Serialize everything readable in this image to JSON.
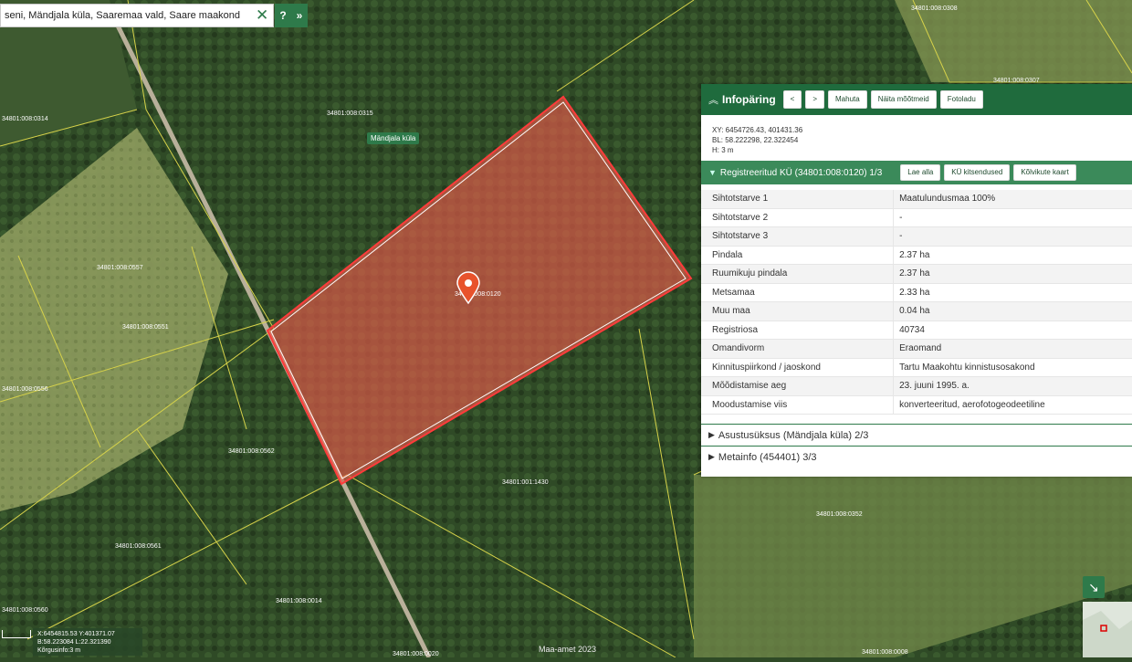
{
  "search": {
    "value": "seni, Mändjala küla, Saaremaa vald, Saare maakond"
  },
  "map": {
    "village_label": "Mändjala küla",
    "selected_parcel_label": "34801:008:0120",
    "parcel_labels": [
      "34801:008:0314",
      "34801:008:0315",
      "34801:008:0557",
      "34801:008:0551",
      "34801:008:0556",
      "34801:008:0562",
      "34801:008:0561",
      "34801:008:0014",
      "34801:008:0560",
      "34801:001:1430",
      "34801:008:0352",
      "34801:008:0308",
      "34801:008:0307",
      "34801:008:0020",
      "34801:008:0008"
    ],
    "copyright": "Maa-amet 2023"
  },
  "infopanel": {
    "title": "Infopäring",
    "buttons": [
      "<",
      ">",
      "Mahuta",
      "Näita mõõtmeid",
      "Fotoladu"
    ],
    "xy": "XY: 6454726.43, 401431.36",
    "bl": "BL: 58.222298, 22.322454",
    "h": "H: 3 m",
    "registered": {
      "title": "Registreeritud KÜ (34801:008:0120) 1/3",
      "buttons": [
        "Lae alla",
        "KÜ kitsendused",
        "Kõlvikute kaart"
      ],
      "rows": [
        {
          "label": "Sihtotstarve 1",
          "value": "Maatulundusmaa 100%"
        },
        {
          "label": "Sihtotstarve 2",
          "value": "-"
        },
        {
          "label": "Sihtotstarve 3",
          "value": "-"
        },
        {
          "label": "Pindala",
          "value": "2.37 ha"
        },
        {
          "label": "Ruumikuju pindala",
          "value": "2.37 ha"
        },
        {
          "label": "Metsamaa",
          "value": "2.33 ha"
        },
        {
          "label": "Muu maa",
          "value": "0.04 ha"
        },
        {
          "label": "Registriosa",
          "value": "40734"
        },
        {
          "label": "Omandivorm",
          "value": "Eraomand"
        },
        {
          "label": "Kinnituspiirkond / jaoskond",
          "value": "Tartu Maakohtu kinnistusosakond"
        },
        {
          "label": "Mõõdistamise aeg",
          "value": "23. juuni 1995. a."
        },
        {
          "label": "Moodustamise viis",
          "value": "konverteeritud, aerofotogeodeetiline"
        }
      ]
    },
    "asustusyksus": "Asustusüksus (Mändjala küla) 2/3",
    "metainfo": "Metainfo (454401) 3/3"
  },
  "footer": {
    "xy": "X:6454815.53 Y:401371.07",
    "bl": "B:58.223084 L:22.321390",
    "height": "Kõrgusinfo:3 m"
  },
  "colors": {
    "accent": "#1f6b3d",
    "parcel_fill": "#e05a4a",
    "forest": "#2f4a26",
    "field": "#8a9a5a"
  }
}
